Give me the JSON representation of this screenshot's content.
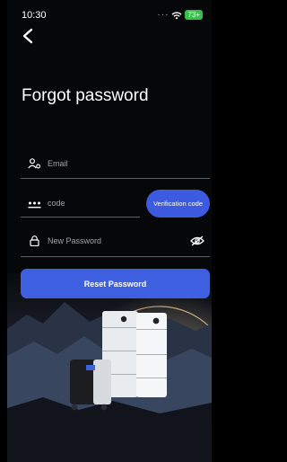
{
  "status": {
    "time": "10:30",
    "battery": "73+"
  },
  "title": "Forgot password",
  "email": {
    "placeholder": "Email"
  },
  "code": {
    "placeholder": "code"
  },
  "verify": {
    "label": "Verification code"
  },
  "password": {
    "placeholder": "New Password"
  },
  "reset": {
    "label": "Reset Password"
  },
  "colors": {
    "accent": "#3f5fe1",
    "background": "#060708"
  }
}
